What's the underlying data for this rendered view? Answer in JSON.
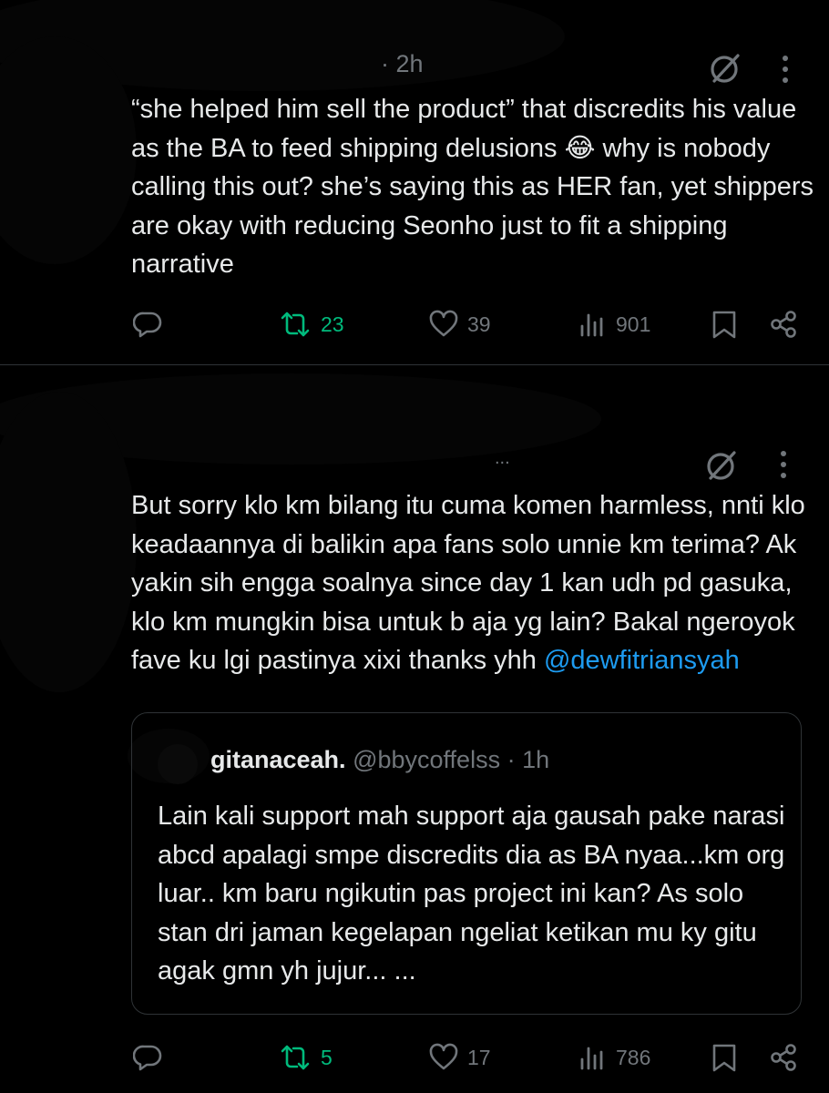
{
  "tweet1": {
    "timestamp": "· 2h",
    "text": "“she helped him sell the product” that discredits his value as the BA to feed shipping delusions 😂 why is nobody calling this out? she’s saying this as HER fan, yet shippers are okay with reducing Seonho just to fit a shipping narrative",
    "actions": {
      "retweets": "23",
      "likes": "39",
      "views": "901"
    }
  },
  "tweet2": {
    "meta_dots": "...",
    "text": "But sorry klo km bilang itu cuma komen harmless, nnti klo keadaannya di balikin apa fans solo unnie km terima? Ak yakin sih engga soalnya since day 1 kan udh pd gasuka, klo km mungkin bisa untuk b aja yg lain? Bakal ngeroyok fave ku lgi pastinya xixi thanks yhh",
    "mention": "@dewfitriansyah",
    "quote": {
      "name": "gitanaceah.",
      "handle": "@bbycoffelss",
      "time": "· 1h",
      "text": "Lain kali support mah support aja gausah pake narasi abcd apalagi smpe discredits dia as BA nyaa...km org luar.. km baru ngikutin pas project ini kan? As solo stan dri jaman kegelapan ngeliat ketikan mu ky gitu agak gmn yh jujur... ..."
    },
    "actions": {
      "retweets": "5",
      "likes": "17",
      "views": "786"
    }
  },
  "colors": {
    "background": "#000000",
    "text": "#e7e9ea",
    "muted": "#71767b",
    "repost_active": "#00ba7c",
    "link": "#1d9bf0"
  }
}
